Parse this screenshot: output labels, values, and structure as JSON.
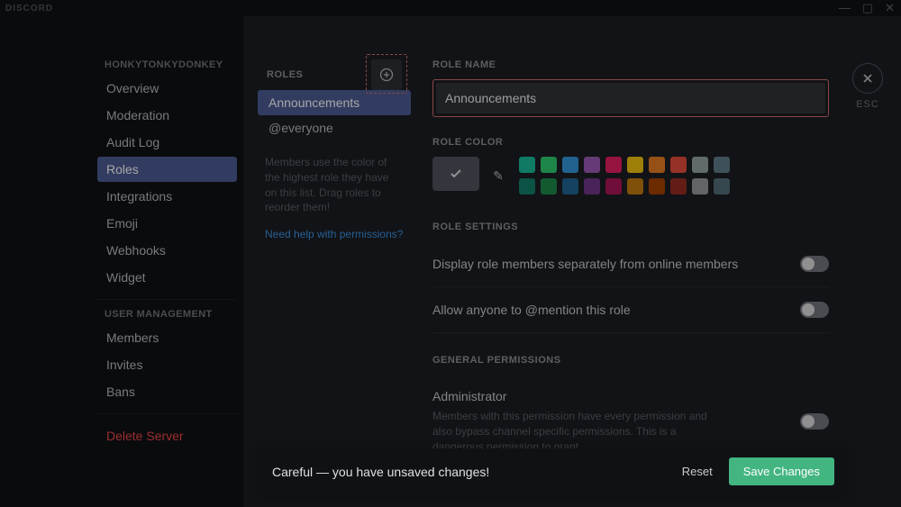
{
  "app_name": "DISCORD",
  "server_name": "HONKYTONKYDONKEY",
  "sidebar": {
    "sections": [
      {
        "header": "HONKYTONKYDONKEY",
        "items": [
          "Overview",
          "Moderation",
          "Audit Log",
          "Roles",
          "Integrations",
          "Emoji",
          "Webhooks",
          "Widget"
        ],
        "selected_index": 3
      },
      {
        "header": "USER MANAGEMENT",
        "items": [
          "Members",
          "Invites",
          "Bans"
        ]
      }
    ],
    "delete": "Delete Server"
  },
  "roles_panel": {
    "header": "ROLES",
    "items": [
      "Announcements",
      "@everyone"
    ],
    "selected_index": 0,
    "hint": "Members use the color of the highest role they have on this list. Drag roles to reorder them!",
    "perm_link": "Need help with permissions?"
  },
  "role_name": {
    "label": "ROLE NAME",
    "value": "Announcements"
  },
  "role_color": {
    "label": "ROLE COLOR",
    "swatches_row1": [
      "#1abc9c",
      "#2ecc71",
      "#3498db",
      "#9b59b6",
      "#e91e63",
      "#f1c40f",
      "#e67e22",
      "#e74c3c",
      "#95a5a6",
      "#607d8b"
    ],
    "swatches_row2": [
      "#11806a",
      "#1f8b4c",
      "#206694",
      "#71368a",
      "#ad1457",
      "#c27c0e",
      "#a84300",
      "#992d22",
      "#979c9f",
      "#546e7a"
    ]
  },
  "role_settings": {
    "header": "ROLE SETTINGS",
    "items": [
      {
        "label": "Display role members separately from online members",
        "value": false
      },
      {
        "label": "Allow anyone to @mention this role",
        "value": false
      }
    ]
  },
  "general_permissions": {
    "header": "GENERAL PERMISSIONS",
    "items": [
      {
        "label": "Administrator",
        "value": false,
        "desc": "Members with this permission have every permission and also bypass channel specific permissions. This is a dangerous permission to grant."
      }
    ]
  },
  "close": {
    "label": "ESC"
  },
  "unsaved": {
    "message": "Careful — you have unsaved changes!",
    "reset": "Reset",
    "save": "Save Changes"
  }
}
